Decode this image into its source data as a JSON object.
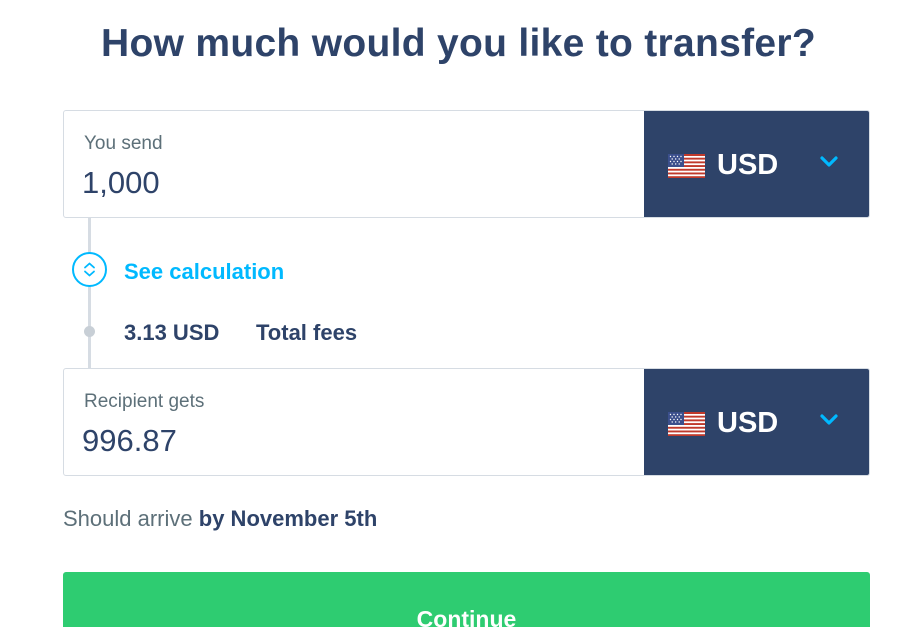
{
  "header": {
    "title": "How much would you like to transfer?"
  },
  "send": {
    "label": "You send",
    "amount": "1,000",
    "currency": {
      "code": "USD",
      "flag_icon": "us-flag-icon"
    }
  },
  "calculation": {
    "link_label": "See calculation",
    "fee_amount": "3.13 USD",
    "fee_label": "Total fees"
  },
  "receive": {
    "label": "Recipient gets",
    "amount": "996.87",
    "currency": {
      "code": "USD",
      "flag_icon": "us-flag-icon"
    }
  },
  "arrival": {
    "prefix": "Should arrive",
    "date": "by November 5th"
  },
  "actions": {
    "continue_label": "Continue"
  },
  "colors": {
    "navy": "#2e4369",
    "accent_blue": "#00b9ff",
    "continue_green": "#2ecc71",
    "muted_text": "#5d7079",
    "border": "#d6dce3"
  }
}
